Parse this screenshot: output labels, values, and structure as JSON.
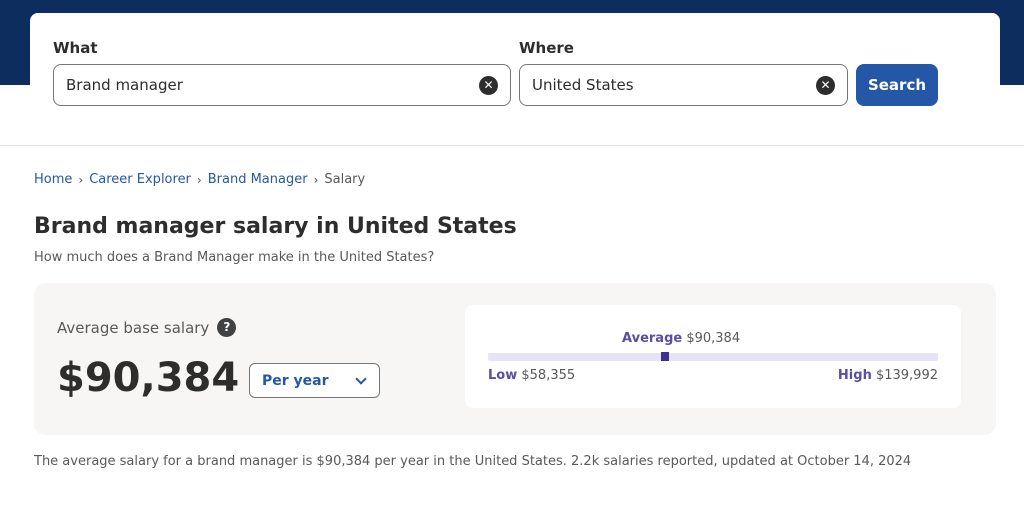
{
  "search": {
    "what_label": "What",
    "what_value": "Brand manager",
    "where_label": "Where",
    "where_value": "United States",
    "clear_glyph": "✕",
    "button_label": "Search"
  },
  "breadcrumb": {
    "items": [
      "Home",
      "Career Explorer",
      "Brand Manager"
    ],
    "separator": "›",
    "current": "Salary"
  },
  "page": {
    "title": "Brand manager salary in United States",
    "subtitle": "How much does a Brand Manager make in the United States?"
  },
  "salary": {
    "avg_label": "Average base salary",
    "help_glyph": "?",
    "amount": "$90,384",
    "period": "Per year",
    "range": {
      "average_label": "Average",
      "average_value": "$90,384",
      "low_label": "Low",
      "low_value": "$58,355",
      "high_label": "High",
      "high_value": "$139,992",
      "low": 58355,
      "average": 90384,
      "high": 139992
    }
  },
  "summary": "The average salary for a brand manager is $90,384 per year in the United States.  2.2k salaries reported, updated at October 14, 2024",
  "colors": {
    "header_band": "#0d2d5e",
    "primary": "#2557a7",
    "accent_purple": "#5d4ca3",
    "range_bar": "#e6e3f7",
    "range_marker": "#3c2f8f",
    "panel_bg": "#f7f6f4"
  },
  "icons": {
    "clear": "close-circle-icon",
    "help": "question-circle-icon",
    "dropdown": "chevron-down-icon"
  }
}
